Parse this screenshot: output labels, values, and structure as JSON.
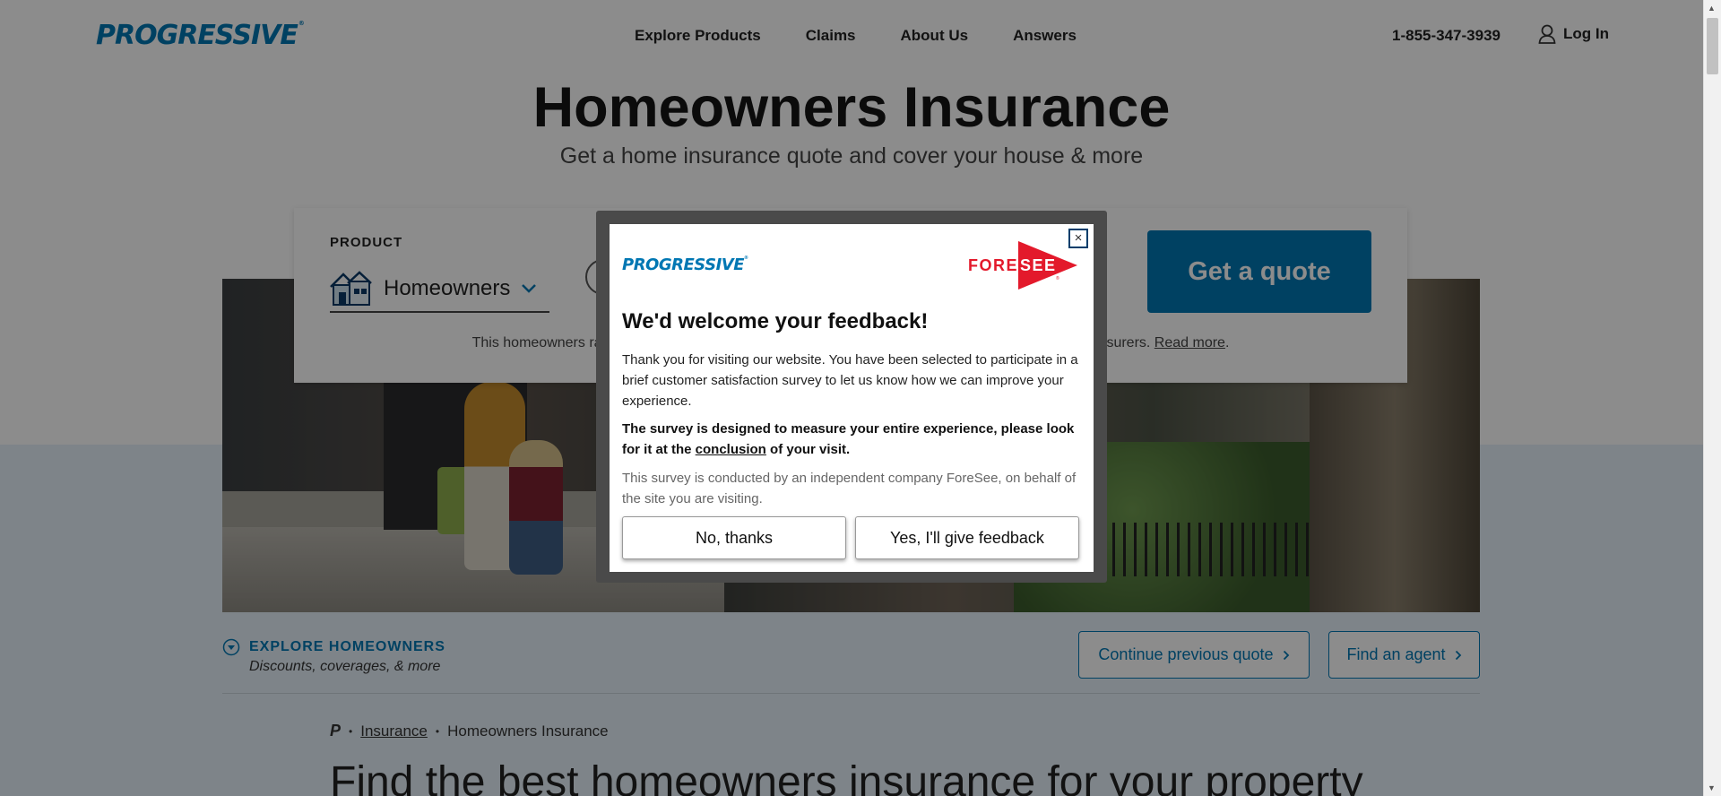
{
  "header": {
    "logo": "PROGRESSIVE",
    "logo_mark": "®",
    "nav": [
      "Explore Products",
      "Claims",
      "About Us",
      "Answers"
    ],
    "phone": "1-855-347-3939",
    "login": "Log In",
    "login_icon": "user-icon"
  },
  "hero": {
    "title": "Homeowners Insurance",
    "subtitle": "Get a home insurance quote and cover your house & more"
  },
  "quote": {
    "product_label": "PRODUCT",
    "product_value": "Homeowners",
    "product_icon": "house-icon",
    "quote_button": "Get a quote",
    "disclaimer_start": "This homeowners ra",
    "disclaimer_end": "nsurers.",
    "read_more": "Read more",
    "period": "."
  },
  "explore": {
    "title": "EXPLORE HOMEOWNERS",
    "subtitle": "Discounts, coverages, & more",
    "continue_button": "Continue previous quote",
    "agent_button": "Find an agent"
  },
  "breadcrumb": {
    "home": "P",
    "insurance": "Insurance",
    "current": "Homeowners Insurance"
  },
  "article": {
    "title": "Find the best homeowners insurance for your property"
  },
  "modal": {
    "logo": "PROGRESSIVE",
    "brand_left": "FORE",
    "brand_right": "SEE",
    "brand_mark": "®",
    "close": "×",
    "title": "We'd welcome your feedback!",
    "body": "Thank you for visiting our website. You have been selected to participate in a brief customer satisfaction survey to let us know how we can improve your experience.",
    "emph_start": "The survey is designed to measure your entire experience, please look for it at the ",
    "emph_link": "conclusion",
    "emph_end": " of your visit.",
    "note": "This survey is conducted by an independent company ForeSee, on behalf of the site you are visiting.",
    "no_button": "No, thanks",
    "yes_button": "Yes, I'll give feedback"
  },
  "colors": {
    "brand_blue": "#0077b3",
    "foresee_red": "#e3192b",
    "overlay": "rgba(0,0,0,0.45)"
  }
}
